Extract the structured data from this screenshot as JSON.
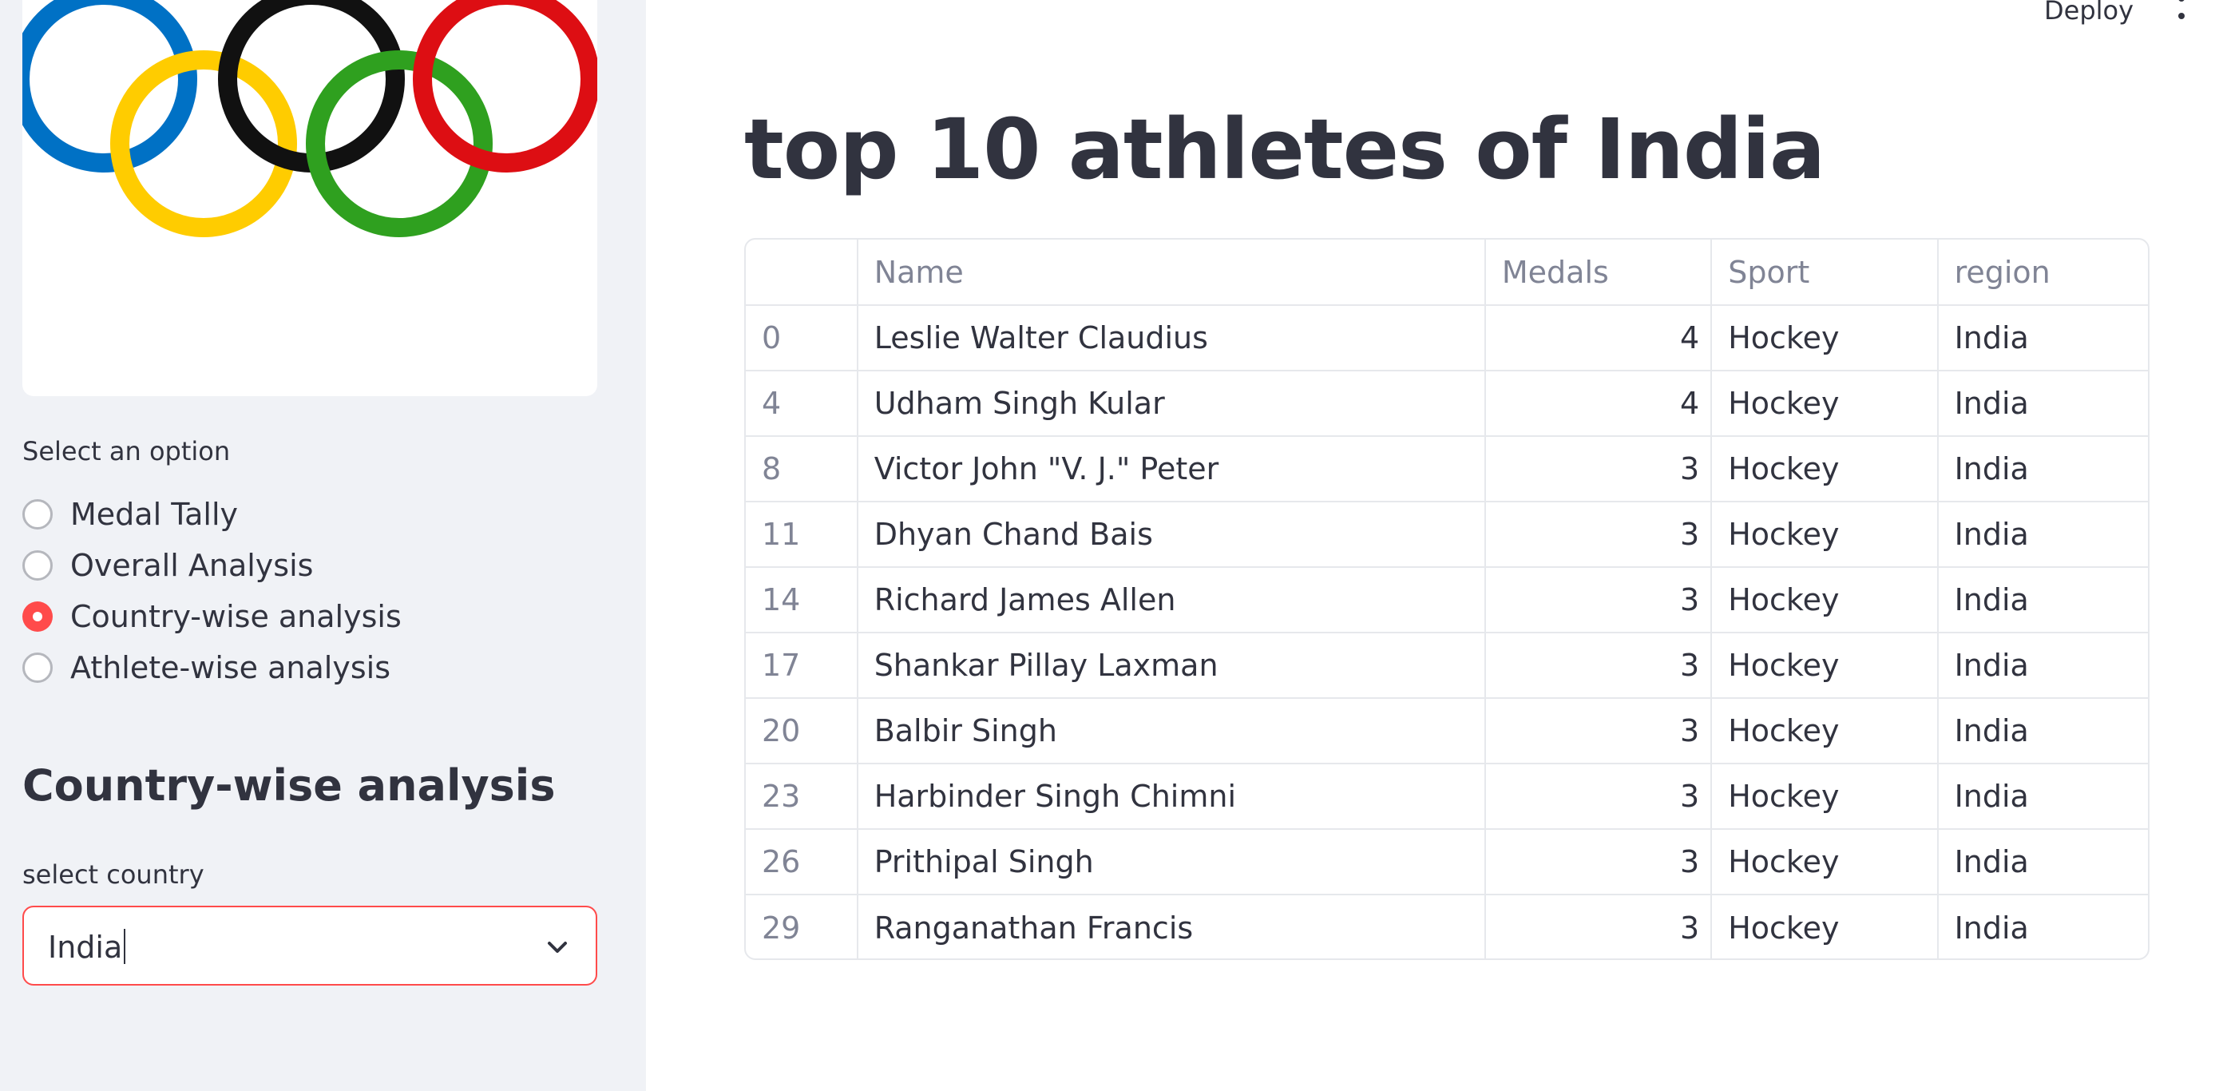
{
  "sidebar": {
    "radio_label": "Select an option",
    "options": [
      {
        "label": "Medal Tally",
        "checked": false
      },
      {
        "label": "Overall Analysis",
        "checked": false
      },
      {
        "label": "Country-wise analysis",
        "checked": true
      },
      {
        "label": "Athlete-wise analysis",
        "checked": false
      }
    ],
    "section_heading": "Country-wise analysis",
    "select_label": "select country",
    "select_value": "India",
    "accent_color": "#ff4b4b"
  },
  "header": {
    "deploy_label": "Deploy"
  },
  "main": {
    "title": "top 10 athletes of India",
    "table": {
      "columns": [
        "",
        "Name",
        "Medals",
        "Sport",
        "region"
      ],
      "rows": [
        {
          "index": "0",
          "name": "Leslie Walter Claudius",
          "medals": "4",
          "sport": "Hockey",
          "region": "India"
        },
        {
          "index": "4",
          "name": "Udham Singh Kular",
          "medals": "4",
          "sport": "Hockey",
          "region": "India"
        },
        {
          "index": "8",
          "name": "Victor John \"V. J.\" Peter",
          "medals": "3",
          "sport": "Hockey",
          "region": "India"
        },
        {
          "index": "11",
          "name": "Dhyan Chand Bais",
          "medals": "3",
          "sport": "Hockey",
          "region": "India"
        },
        {
          "index": "14",
          "name": "Richard James Allen",
          "medals": "3",
          "sport": "Hockey",
          "region": "India"
        },
        {
          "index": "17",
          "name": "Shankar Pillay Laxman",
          "medals": "3",
          "sport": "Hockey",
          "region": "India"
        },
        {
          "index": "20",
          "name": "Balbir Singh",
          "medals": "3",
          "sport": "Hockey",
          "region": "India"
        },
        {
          "index": "23",
          "name": "Harbinder Singh Chimni",
          "medals": "3",
          "sport": "Hockey",
          "region": "India"
        },
        {
          "index": "26",
          "name": "Prithipal Singh",
          "medals": "3",
          "sport": "Hockey",
          "region": "India"
        },
        {
          "index": "29",
          "name": "Ranganathan Francis",
          "medals": "3",
          "sport": "Hockey",
          "region": "India"
        }
      ]
    }
  },
  "icons": {
    "logo": "olympic-rings-logo",
    "select_chevron": "chevron-down-icon",
    "menu": "more-vertical-icon"
  },
  "ring_colors": [
    "#0081c8",
    "#fcb131",
    "#000000",
    "#00a651",
    "#ee334e"
  ]
}
